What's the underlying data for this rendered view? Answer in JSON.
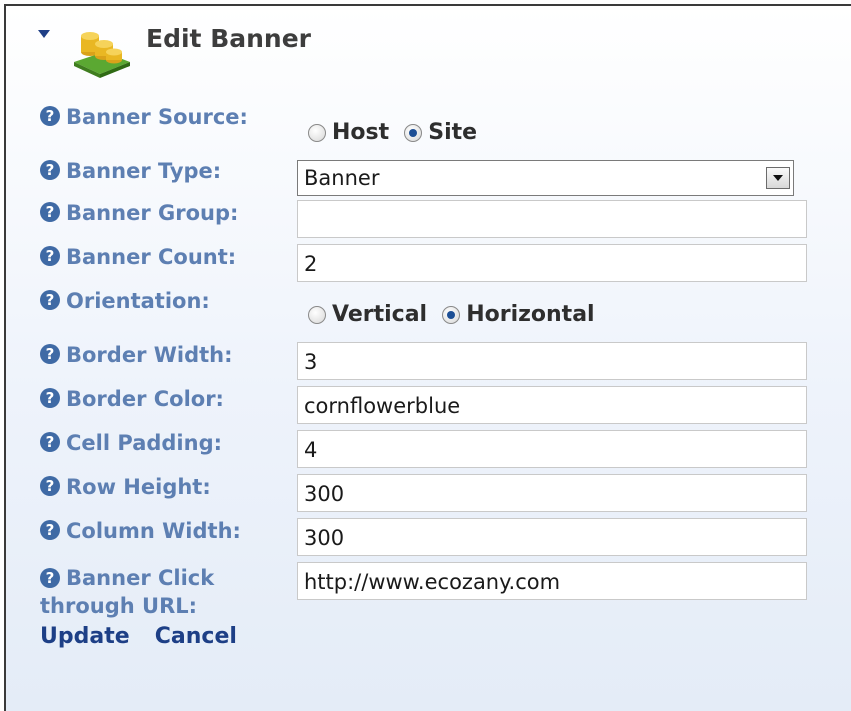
{
  "header": {
    "title": "Edit Banner"
  },
  "form": {
    "banner_source": {
      "label": "Banner Source:",
      "options": [
        "Host",
        "Site"
      ],
      "selected": "Site"
    },
    "banner_type": {
      "label": "Banner Type:",
      "value": "Banner"
    },
    "banner_group": {
      "label": "Banner Group:",
      "value": ""
    },
    "banner_count": {
      "label": "Banner Count:",
      "value": "2"
    },
    "orientation": {
      "label": "Orientation:",
      "options": [
        "Vertical",
        "Horizontal"
      ],
      "selected": "Horizontal"
    },
    "border_width": {
      "label": "Border Width:",
      "value": "3"
    },
    "border_color": {
      "label": "Border Color:",
      "value": "cornflowerblue"
    },
    "cell_padding": {
      "label": "Cell Padding:",
      "value": "4"
    },
    "row_height": {
      "label": "Row Height:",
      "value": "300"
    },
    "column_width": {
      "label": "Column Width:",
      "value": "300"
    },
    "click_url": {
      "label_line1": "Banner Click",
      "label_line2": "through URL:",
      "value": "http://www.ecozany.com"
    }
  },
  "actions": {
    "update": "Update",
    "cancel": "Cancel"
  },
  "icons": {
    "collapse": "triangle-down-icon",
    "module": "coins-stack-icon",
    "help": "question-circle-icon"
  },
  "colors": {
    "label": "#5d7fb2",
    "link": "#1d3f86",
    "help_icon": "#3f6aa5",
    "title": "#3d3d3d"
  }
}
